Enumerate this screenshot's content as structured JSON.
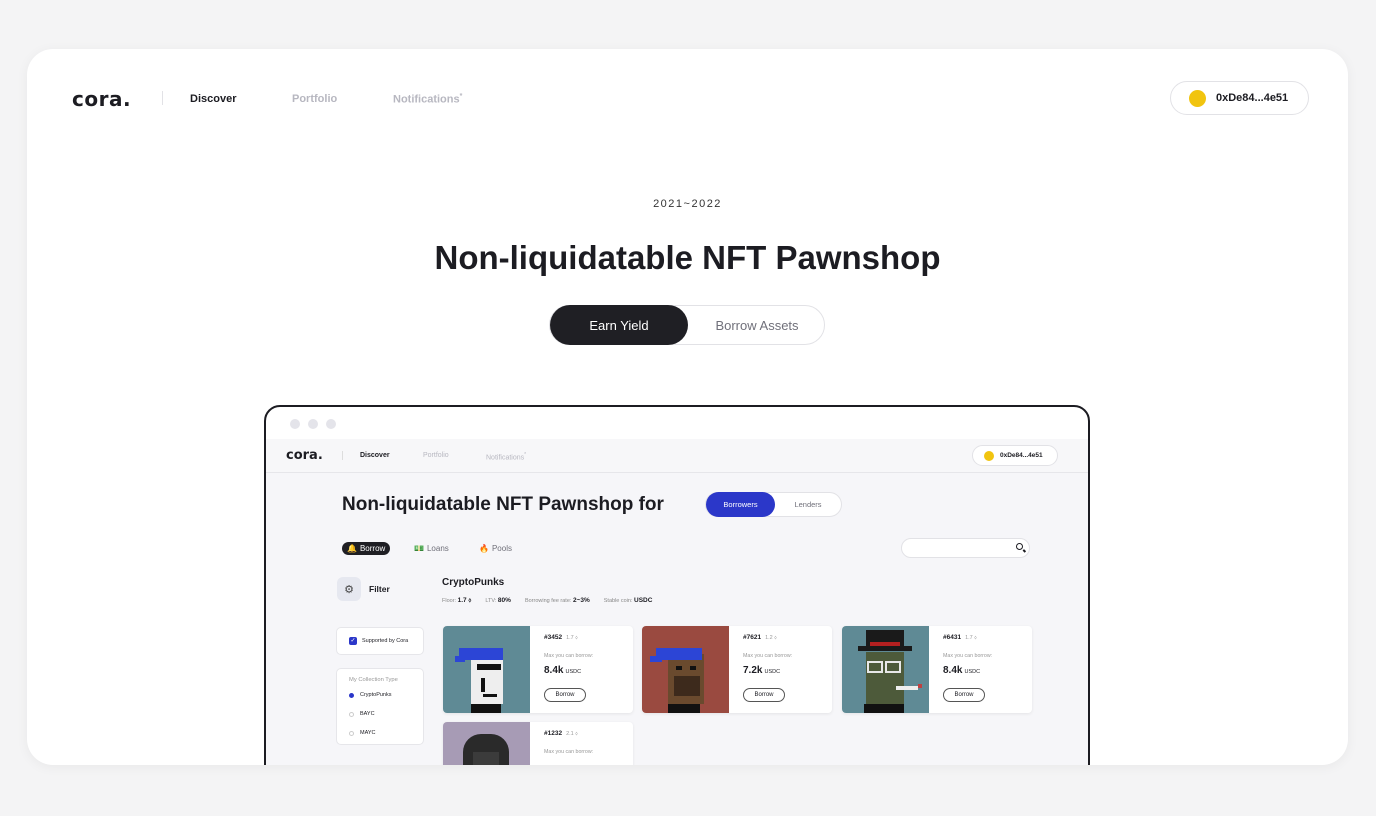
{
  "nav": {
    "logo": "cora.",
    "items": [
      "Discover",
      "Portfolio",
      "Notifications"
    ],
    "notification_mark": "*",
    "wallet_address": "0xDe84...4e51"
  },
  "hero": {
    "years": "2021~2022",
    "title": "Non-liquidatable NFT Pawnshop",
    "toggle": [
      "Earn Yield",
      "Borrow Assets"
    ],
    "active_toggle": "Earn Yield"
  },
  "preview": {
    "nav": {
      "logo": "cora.",
      "items": [
        "Discover",
        "Portfolio",
        "Notifications"
      ],
      "notification_mark": "*",
      "wallet_address": "0xDe84...4e51"
    },
    "title": "Non-liquidatable NFT Pawnshop for",
    "toggle": [
      "Borrowers",
      "Lenders"
    ],
    "tabs": [
      {
        "icon": "bell-icon",
        "label": "Borrow"
      },
      {
        "icon": "money-icon",
        "label": "Loans"
      },
      {
        "icon": "fire-icon",
        "label": "Pools"
      }
    ],
    "filter_label": "Filter",
    "supported_label": "Supported by Cora",
    "collection_type_title": "My Collection Type",
    "collection_types": [
      "CryptoPunks",
      "BAYC",
      "MAYC"
    ],
    "selected_type": "CryptoPunks",
    "collection": {
      "name": "CryptoPunks",
      "stats": [
        {
          "label": "Floor:",
          "value": "1.7 ⬨"
        },
        {
          "label": "LTV:",
          "value": "80%"
        },
        {
          "label": "Borrowing fee rate:",
          "value": "2~3%"
        },
        {
          "label": "Stable coin:",
          "value": "USDC"
        }
      ]
    },
    "nfts": [
      {
        "id": "#3452",
        "price": "1.7 ⬨",
        "max_label": "Max you can borrow:",
        "amount": "8.4k",
        "unit": "USDC",
        "button": "Borrow",
        "bg": "#5f8a95"
      },
      {
        "id": "#7621",
        "price": "1.2 ⬨",
        "max_label": "Max you can borrow:",
        "amount": "7.2k",
        "unit": "USDC",
        "button": "Borrow",
        "bg": "#9a4a40"
      },
      {
        "id": "#6431",
        "price": "1.7 ⬨",
        "max_label": "Max you can borrow:",
        "amount": "8.4k",
        "unit": "USDC",
        "button": "Borrow",
        "bg": "#5f8a95"
      },
      {
        "id": "#1232",
        "price": "2.1 ⬨",
        "max_label": "Max you can borrow:",
        "amount": "",
        "unit": "",
        "button": "",
        "bg": "#a79bb5"
      }
    ]
  },
  "colors": {
    "accent": "#2b37c9",
    "dark": "#1f1f24",
    "coin": "#f1c40f"
  }
}
